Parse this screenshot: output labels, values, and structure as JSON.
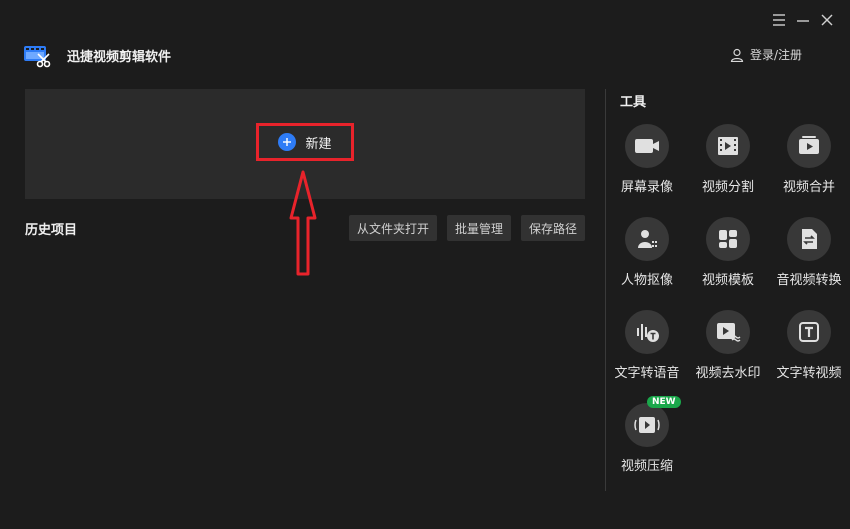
{
  "app": {
    "title": "迅捷视频剪辑软件"
  },
  "header": {
    "login_label": "登录/注册"
  },
  "new_project": {
    "label": "新建"
  },
  "history": {
    "title": "历史项目",
    "buttons": [
      "从文件夹打开",
      "批量管理",
      "保存路径"
    ]
  },
  "tools": {
    "title": "工具",
    "items": [
      {
        "label": "屏幕录像",
        "icon": "camera-icon"
      },
      {
        "label": "视频分割",
        "icon": "film-split-icon"
      },
      {
        "label": "视频合并",
        "icon": "video-merge-icon"
      },
      {
        "label": "人物抠像",
        "icon": "person-matting-icon"
      },
      {
        "label": "视频模板",
        "icon": "template-grid-icon"
      },
      {
        "label": "音视频转换",
        "icon": "convert-icon"
      },
      {
        "label": "文字转语音",
        "icon": "text-to-speech-icon"
      },
      {
        "label": "视频去水印",
        "icon": "remove-watermark-icon"
      },
      {
        "label": "文字转视频",
        "icon": "text-to-video-icon"
      },
      {
        "label": "视频压缩",
        "icon": "video-compress-icon"
      }
    ],
    "new_badge": "NEW"
  },
  "colors": {
    "background": "#1c1c1c",
    "panel": "#2b2b2b",
    "accent_blue": "#2e7cf6",
    "highlight_red": "#e8232b",
    "badge_green": "#1aa84b"
  }
}
